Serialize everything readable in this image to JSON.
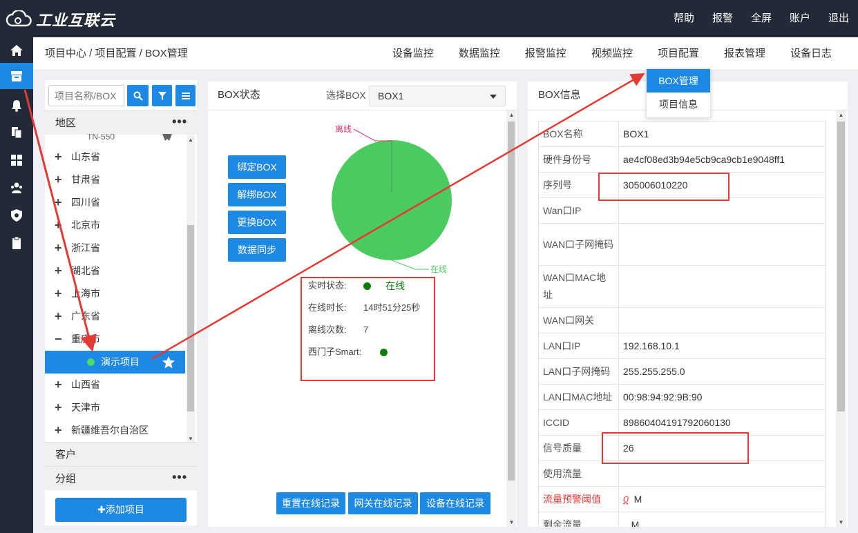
{
  "app": {
    "logo_text": "工业互联云",
    "topnav": [
      "帮助",
      "报警",
      "全屏",
      "账户",
      "退出"
    ]
  },
  "sidebar_icons": [
    "home-icon",
    "archive-icon",
    "bell-icon",
    "copy-icon",
    "grid-icon",
    "users-icon",
    "shield-icon",
    "clipboard-icon"
  ],
  "header": {
    "breadcrumb": "项目中心 / 项目配置 / BOX管理",
    "nav": [
      "设备监控",
      "数据监控",
      "报警监控",
      "视频监控",
      "项目配置",
      "报表管理",
      "设备日志"
    ]
  },
  "dropdown": {
    "items": [
      "BOX管理",
      "项目信息"
    ],
    "active": "BOX管理"
  },
  "left_panel": {
    "search_placeholder": "项目名称/BOX",
    "region_header": "地区",
    "partial_item": "TN-550",
    "tree": [
      {
        "label": "山东省",
        "expander": "+"
      },
      {
        "label": "甘肃省",
        "expander": "+"
      },
      {
        "label": "四川省",
        "expander": "+"
      },
      {
        "label": "北京市",
        "expander": "+"
      },
      {
        "label": "浙江省",
        "expander": "+"
      },
      {
        "label": "湖北省",
        "expander": "+"
      },
      {
        "label": "上海市",
        "expander": "+"
      },
      {
        "label": "广东省",
        "expander": "+"
      },
      {
        "label": "重庆市",
        "expander": "−"
      },
      {
        "label": "演示项目",
        "selected": true
      },
      {
        "label": "山西省",
        "expander": "+"
      },
      {
        "label": "天津市",
        "expander": "+"
      },
      {
        "label": "新疆维吾尔自治区",
        "expander": "+"
      }
    ],
    "customer_header": "客户",
    "group_header": "分组",
    "add_button": "✚添加项目"
  },
  "center_panel": {
    "title": "BOX状态",
    "select_label": "选择BOX",
    "select_value": "BOX1",
    "buttons": [
      "绑定BOX",
      "解绑BOX",
      "更换BOX",
      "数据同步"
    ],
    "chart_data": {
      "type": "pie",
      "categories": [
        "在线",
        "离线"
      ],
      "values": [
        100,
        0
      ],
      "colors": [
        "#4bcb5f",
        "#e0306a"
      ]
    },
    "status": {
      "realtime_label": "实时状态:",
      "realtime_value": "在线",
      "online_label": "在线时长:",
      "online_value": "14时51分25秒",
      "offline_label": "离线次数:",
      "offline_value": "7",
      "smart_label": "西门子Smart:"
    },
    "bottom_buttons": [
      "重置在线记录",
      "网关在线记录",
      "设备在线记录"
    ]
  },
  "right_panel": {
    "title": "BOX信息",
    "rows": [
      {
        "key": "BOX名称",
        "value": "BOX1"
      },
      {
        "key": "硬件身份号",
        "value": "ae4cf08ed3b94e5cb9ca9cb1e9048ff1"
      },
      {
        "key": "序列号",
        "value": "305006010220"
      },
      {
        "key": "Wan口IP",
        "value": ""
      },
      {
        "key": "WAN口子网掩码",
        "value": ""
      },
      {
        "key": "WAN口MAC地址",
        "value": ""
      },
      {
        "key": "WAN口网关",
        "value": ""
      },
      {
        "key": "LAN口IP",
        "value": "192.168.10.1"
      },
      {
        "key": "LAN口子网掩码",
        "value": "255.255.255.0"
      },
      {
        "key": "LAN口MAC地址",
        "value": "00:98:94:92:9B:90"
      },
      {
        "key": "ICCID",
        "value": "89860404191792060130"
      },
      {
        "key": "信号质量",
        "value": "26"
      },
      {
        "key": "使用流量",
        "value": ""
      },
      {
        "key": "流量预警阈值",
        "value": "0",
        "unit": "M",
        "warn": true
      },
      {
        "key": "剩余流量",
        "value": "",
        "unit": "M"
      }
    ]
  },
  "colors": {
    "accent": "#1e88e5",
    "dark": "#212a36",
    "annotation": "#e53935",
    "online": "#4bcb5f"
  }
}
